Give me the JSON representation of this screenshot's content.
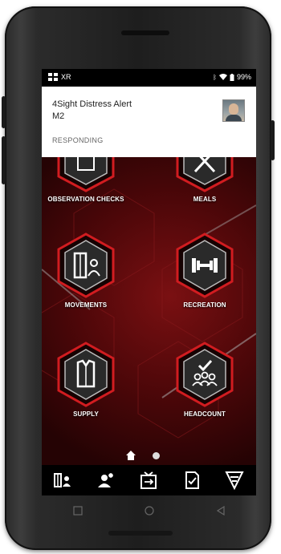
{
  "status_bar": {
    "app_label": "XR",
    "battery": "99%"
  },
  "notification": {
    "title": "4Sight Distress Alert",
    "subtitle": "M2",
    "action": "RESPONDING"
  },
  "tiles": [
    {
      "label": "OBSERVATION CHECKS",
      "icon": "clipboard-icon"
    },
    {
      "label": "MEALS",
      "icon": "utensils-icon"
    },
    {
      "label": "MOVEMENTS",
      "icon": "door-person-icon"
    },
    {
      "label": "RECREATION",
      "icon": "dumbbell-icon"
    },
    {
      "label": "SUPPLY",
      "icon": "shirt-icon"
    },
    {
      "label": "HEADCOUNT",
      "icon": "group-check-icon"
    }
  ],
  "bottom_nav": [
    "movements-icon",
    "add-person-icon",
    "transfer-icon",
    "checklist-icon",
    "logo-icon"
  ],
  "colors": {
    "accent": "#c8171b",
    "background": "#4d0709"
  }
}
